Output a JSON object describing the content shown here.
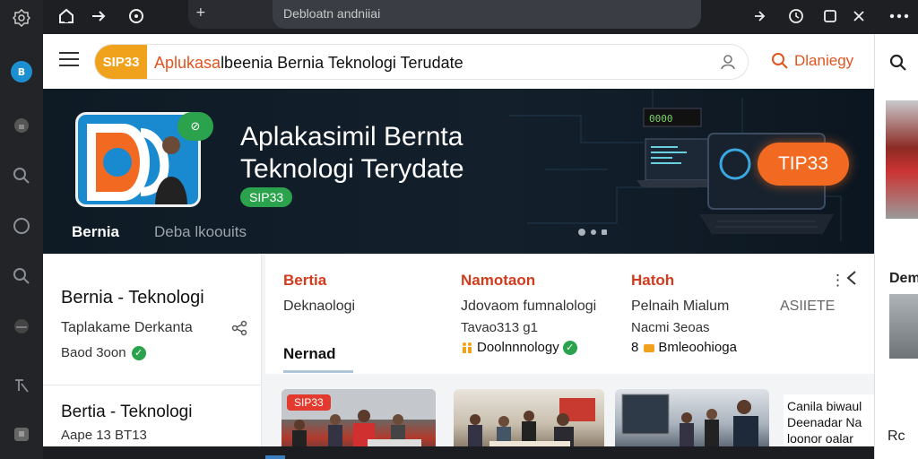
{
  "browser": {
    "address_text": "Debloatn andniiai",
    "new_tab_label": "+"
  },
  "rail": {
    "active_label": "B"
  },
  "header": {
    "brand": "SIP33",
    "search_prefix": "Aplukasa",
    "search_rest": "lbeenia Bernia Teknologi Terudate",
    "search_button_label": "Dlaniegy"
  },
  "hero": {
    "title": "Aplakasimil Bernta Teknologi Terydate",
    "tag": "SIP33",
    "tab_active": "Bernia",
    "tab_inactive": "Deba  lkoouits",
    "cta": "TIP33",
    "badge_icon": "link-icon",
    "laptop_indicator": "0000"
  },
  "left_panel": {
    "title": "Bernia - Teknologi",
    "subtitle": "Taplakame Derkanta",
    "meta": "Baod 3oon",
    "title2": "Bertia - Teknologi",
    "meta2": "Aape 13 BT13"
  },
  "content": {
    "categories": [
      {
        "title": "Bertia",
        "sub": "Deknaologi"
      },
      {
        "title": "Namotaon",
        "sub": "Jdovaom fumnalologi",
        "line": "Tavao313 g1",
        "foot": "Doolnnnology"
      },
      {
        "title": "Hatoh",
        "sub": "Pelnaih Mialum",
        "line": "Nacmi 3eoas",
        "foot": "Bmleoohioga",
        "foot_prefix": "8"
      }
    ],
    "extra_label": "ASIIETE",
    "section_label": "Nernad"
  },
  "cards": {
    "tag": "SIP33",
    "text_lines": [
      "Canila biwaul",
      "Deenadar Na",
      "loonor oalar"
    ]
  },
  "right_column": {
    "heading": "Dem",
    "foot": "Rc"
  },
  "colors": {
    "accent": "#e2541f",
    "brand": "#f0a21d",
    "success": "#2ba24c",
    "hero_bg": "#0e1a24",
    "cta": "#f26a21"
  }
}
